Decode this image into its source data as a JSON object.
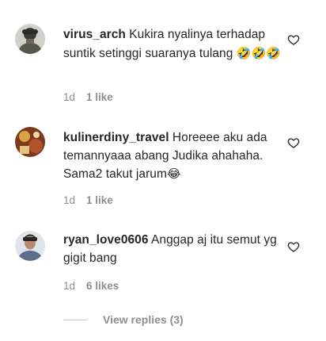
{
  "comments": [
    {
      "username": "virus_arch",
      "text": " Kukira nyalinya terhadap suntik setinggi suaranya tulang ",
      "emoji": "🤣🤣🤣",
      "age": "1d",
      "likes": "1 like",
      "avatar_icon": "user-avatar"
    },
    {
      "username": "kulinerdiny_travel",
      "text": " Horeeee aku ada temannyaaa abang Judika ahahaha. Sama2 takut jarum",
      "emoji": "😂",
      "age": "1d",
      "likes": "1 like",
      "avatar_icon": "user-avatar"
    },
    {
      "username": "ryan_love0606",
      "text": " Anggap aj itu semut yg gigit bang",
      "emoji": "",
      "age": "1d",
      "likes": "6 likes",
      "avatar_icon": "user-avatar"
    }
  ],
  "view_replies": "View replies (3)",
  "colors": {
    "text": "#262626",
    "muted": "#8e8e8e",
    "divider": "#c7c7c7"
  }
}
